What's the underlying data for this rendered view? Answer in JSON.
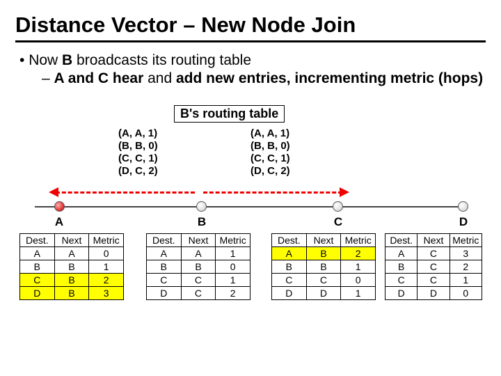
{
  "title": "Distance Vector – New Node Join",
  "bullets": {
    "b1_pre": "Now ",
    "b1_bold": "B",
    "b1_post": " broadcasts its routing table",
    "b2_bold1": "A and C hear",
    "b2_mid": " and ",
    "b2_bold2": "add new entries, incrementing metric (hops)"
  },
  "rt_label": "B's routing table",
  "tuples_left": [
    "(A, A, 1)",
    "(B, B, 0)",
    "(C, C, 1)",
    "(D, C, 2)"
  ],
  "tuples_right": [
    "(A, A, 1)",
    "(B, B, 0)",
    "(C, C, 1)",
    "(D, C, 2)"
  ],
  "nodes": {
    "A": "A",
    "B": "B",
    "C": "C",
    "D": "D"
  },
  "headers": [
    "Dest.",
    "Next",
    "Metric"
  ],
  "tables": {
    "A": {
      "highlighted": [
        2,
        3
      ],
      "rows": [
        [
          "A",
          "A",
          "0"
        ],
        [
          "B",
          "B",
          "1"
        ],
        [
          "C",
          "B",
          "2"
        ],
        [
          "D",
          "B",
          "3"
        ]
      ]
    },
    "B": {
      "highlighted": [],
      "rows": [
        [
          "A",
          "A",
          "1"
        ],
        [
          "B",
          "B",
          "0"
        ],
        [
          "C",
          "C",
          "1"
        ],
        [
          "D",
          "C",
          "2"
        ]
      ]
    },
    "C": {
      "highlighted": [
        0
      ],
      "rows": [
        [
          "A",
          "B",
          "2"
        ],
        [
          "B",
          "B",
          "1"
        ],
        [
          "C",
          "C",
          "0"
        ],
        [
          "D",
          "D",
          "1"
        ]
      ]
    },
    "D": {
      "highlighted": [],
      "rows": [
        [
          "A",
          "C",
          "3"
        ],
        [
          "B",
          "C",
          "2"
        ],
        [
          "C",
          "C",
          "1"
        ],
        [
          "D",
          "D",
          "0"
        ]
      ]
    }
  }
}
